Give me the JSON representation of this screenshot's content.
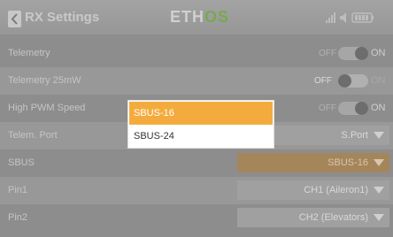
{
  "header": {
    "title": "RX Settings",
    "logo_main": "ETH",
    "logo_accent": "OS",
    "icons": [
      "back-arrow-icon",
      "signal-icon",
      "volume-icon",
      "battery-icon"
    ]
  },
  "rows": [
    {
      "label": "Telemetry",
      "control": "toggle",
      "off": "OFF",
      "on": "ON",
      "state": "on"
    },
    {
      "label": "Telemetry 25mW",
      "control": "toggle",
      "off": "OFF",
      "on": "ON",
      "state": "off"
    },
    {
      "label": "High PWM Speed",
      "control": "toggle",
      "off": "OFF",
      "on": "ON",
      "state": "on"
    },
    {
      "label": "Telem. Port",
      "control": "select",
      "value": "S.Port"
    },
    {
      "label": "SBUS",
      "control": "select",
      "value": "SBUS-16",
      "active": true
    },
    {
      "label": "Pin1",
      "control": "select",
      "value": "CH1 (Aileron1)"
    },
    {
      "label": "Pin2",
      "control": "select",
      "value": "CH2 (Elevators)"
    }
  ],
  "dropdown": {
    "options": [
      "SBUS-16",
      "SBUS-24"
    ],
    "selected": "SBUS-16"
  },
  "colors": {
    "accent_orange": "#f4ab3e",
    "background_dimmed": "#8d8d8d",
    "logo_green": "#77a94e"
  }
}
